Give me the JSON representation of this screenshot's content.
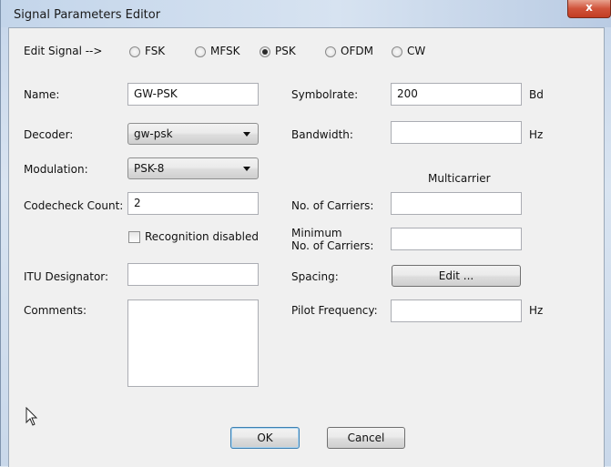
{
  "window": {
    "title": "Signal Parameters Editor",
    "close_glyph": "x"
  },
  "edit_signal": {
    "label": "Edit Signal -->",
    "options": [
      {
        "label": "FSK",
        "selected": false
      },
      {
        "label": "MFSK",
        "selected": false
      },
      {
        "label": "PSK",
        "selected": true
      },
      {
        "label": "OFDM",
        "selected": false
      },
      {
        "label": "CW",
        "selected": false
      }
    ]
  },
  "left": {
    "name_label": "Name:",
    "name_value": "GW-PSK",
    "decoder_label": "Decoder:",
    "decoder_value": "gw-psk",
    "modulation_label": "Modulation:",
    "modulation_value": "PSK-8",
    "codecheck_label": "Codecheck Count:",
    "codecheck_value": "2",
    "recognition_label": "Recognition disabled",
    "recognition_checked": false,
    "itu_label": "ITU Designator:",
    "itu_value": "",
    "comments_label": "Comments:",
    "comments_value": ""
  },
  "right": {
    "symbolrate_label": "Symbolrate:",
    "symbolrate_value": "200",
    "symbolrate_unit": "Bd",
    "bandwidth_label": "Bandwidth:",
    "bandwidth_value": "",
    "bandwidth_unit": "Hz",
    "multicarrier_heading": "Multicarrier",
    "carriers_label": "No. of Carriers:",
    "carriers_value": "",
    "min_carriers_label_1": "Minimum",
    "min_carriers_label_2": "No. of Carriers:",
    "min_carriers_value": "",
    "spacing_label": "Spacing:",
    "spacing_button": "Edit ...",
    "pilot_label": "Pilot Frequency:",
    "pilot_value": "",
    "pilot_unit": "Hz"
  },
  "footer": {
    "ok_label": "OK",
    "cancel_label": "Cancel"
  },
  "icons": {
    "close": "close-icon",
    "cursor": "mouse-pointer-icon",
    "dropdown": "chevron-down-icon"
  },
  "colors": {
    "titlebar": "#c8d8ec",
    "close_button": "#c94a30",
    "client": "#f0f0f0",
    "default_button_border": "#3c7fb1"
  }
}
